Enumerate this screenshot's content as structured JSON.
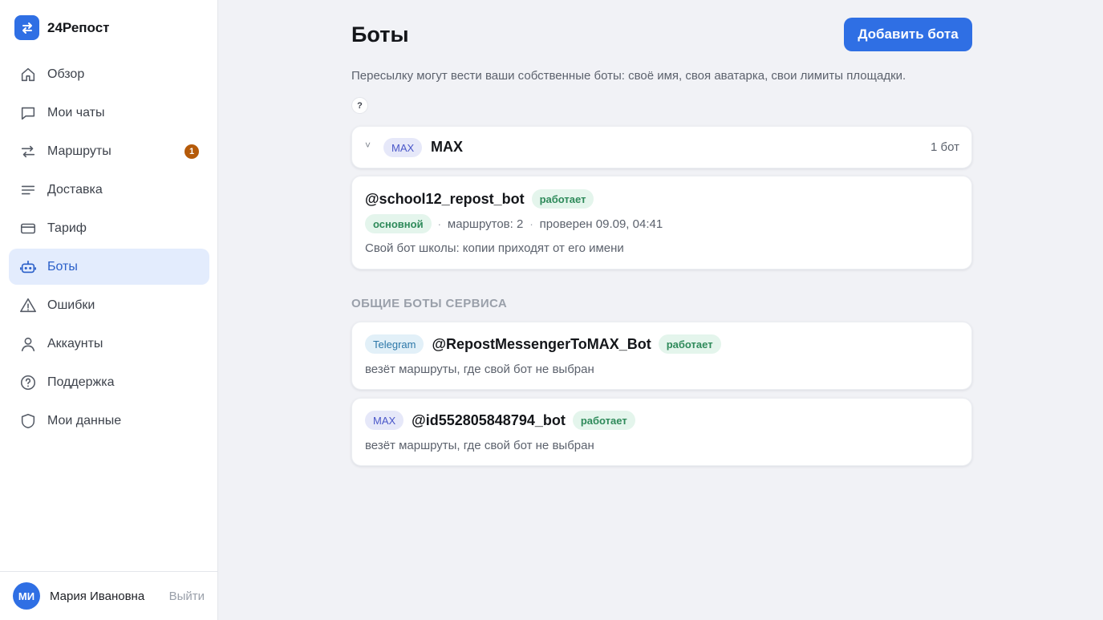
{
  "brand": {
    "name": "24Репост"
  },
  "sidebar": {
    "items": [
      {
        "label": "Обзор",
        "icon": "home-icon"
      },
      {
        "label": "Мои чаты",
        "icon": "chat-icon"
      },
      {
        "label": "Маршруты",
        "icon": "arrows-icon",
        "badge": "1"
      },
      {
        "label": "Доставка",
        "icon": "list-icon"
      },
      {
        "label": "Тариф",
        "icon": "card-icon"
      },
      {
        "label": "Боты",
        "icon": "bot-icon",
        "active": true
      },
      {
        "label": "Ошибки",
        "icon": "warning-icon"
      },
      {
        "label": "Аккаунты",
        "icon": "user-icon"
      },
      {
        "label": "Поддержка",
        "icon": "help-icon"
      },
      {
        "label": "Мои данные",
        "icon": "shield-icon"
      }
    ]
  },
  "user": {
    "initials": "МИ",
    "name": "Мария Ивановна",
    "logout_label": "Выйти"
  },
  "page": {
    "title": "Боты",
    "add_button": "Добавить бота",
    "subtitle": "Пересылку могут вести ваши собственные боты: своё имя, своя аватарка, свои лимиты площадки.",
    "help_label": "?"
  },
  "group": {
    "chevron": "˅",
    "platform": "MAX",
    "name": "MAX",
    "count": "1 бот",
    "bot": {
      "name": "@school12_repost_bot",
      "status": "работает",
      "role": "основной",
      "routes": "маршрутов: 2",
      "checked": "проверен 09.09, 04:41",
      "description": "Свой бот школы: копии приходят от его имени"
    }
  },
  "shared": {
    "section_label": "ОБЩИЕ БОТЫ СЕРВИСА",
    "bots": [
      {
        "platform": "Telegram",
        "name": "@RepostMessengerToMAX_Bot",
        "status": "работает",
        "description": "везёт маршруты, где свой бот не выбран"
      },
      {
        "platform": "MAX",
        "name": "@id552805848794_bot",
        "status": "работает",
        "description": "везёт маршруты, где свой бот не выбран"
      }
    ]
  },
  "colors": {
    "accent": "#2f6fe4",
    "badge": "#b55a09",
    "status_ok": "#2e8a5a"
  }
}
